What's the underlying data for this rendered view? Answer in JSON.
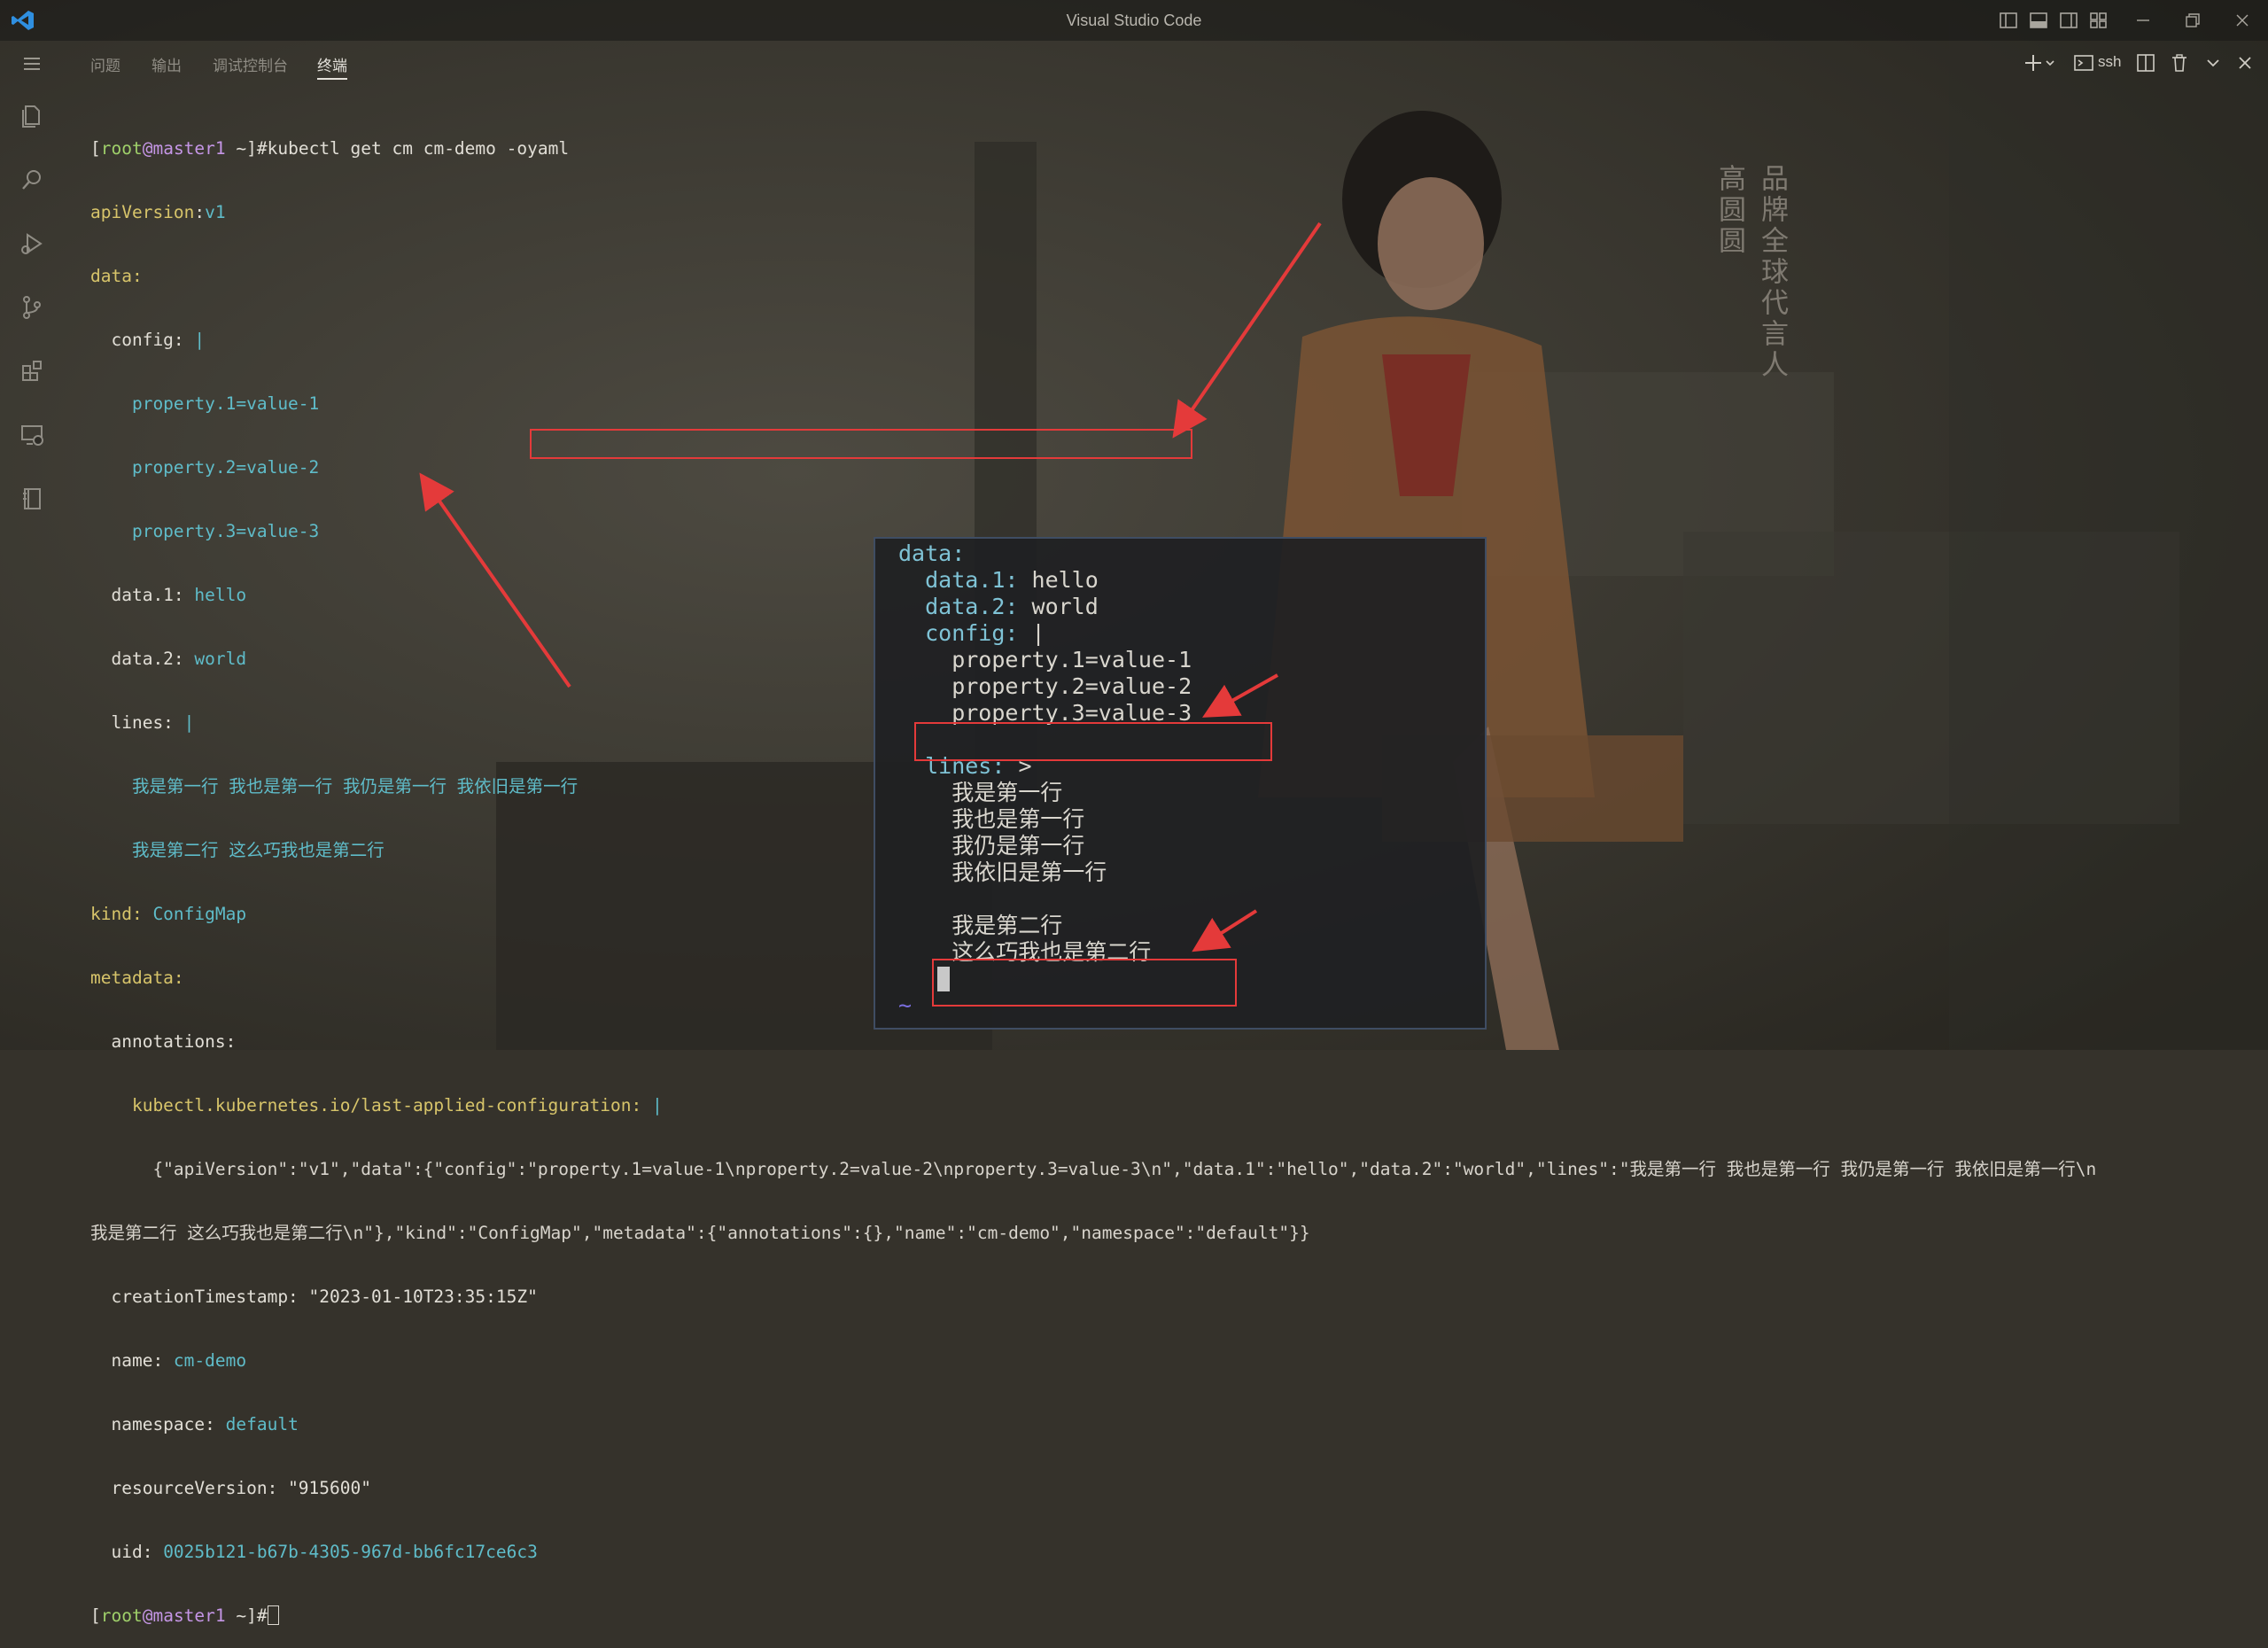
{
  "window": {
    "title": "Visual Studio Code"
  },
  "panel": {
    "tabs": [
      {
        "label": "问题"
      },
      {
        "label": "输出"
      },
      {
        "label": "调试控制台"
      },
      {
        "label": "终端",
        "active": true
      }
    ],
    "terminal_profile": "ssh"
  },
  "terminal": {
    "prompt_user": "root",
    "prompt_host": "@master1",
    "prompt_dir": " ~",
    "command": "#kubectl get cm cm-demo -oyaml",
    "lines": {
      "apiVersion_key": "apiVersion",
      "apiVersion_val": "v1",
      "data_key": "data:",
      "config_key": "  config:",
      "config_pipe": " |",
      "prop1": "    property.1=value-1",
      "prop2": "    property.2=value-2",
      "prop3": "    property.3=value-3",
      "data1_key": "  data.1:",
      "data1_val": " hello",
      "data2_key": "  data.2:",
      "data2_val": " world",
      "lines_key": "  lines:",
      "lines_pipe": " |",
      "lines_row1": "    我是第一行 我也是第一行 我仍是第一行 我依旧是第一行",
      "lines_row2": "    我是第二行 这么巧我也是第二行",
      "kind_key": "kind:",
      "kind_val": " ConfigMap",
      "metadata_key": "metadata:",
      "annotations_key": "  annotations:",
      "last_applied_key": "    kubectl.kubernetes.io/last-applied-configuration:",
      "last_applied_pipe": " |",
      "json_line1": "      {\"apiVersion\":\"v1\",\"data\":{\"config\":\"property.1=value-1\\nproperty.2=value-2\\nproperty.3=value-3\\n\",\"data.1\":\"hello\",\"data.2\":\"world\",\"lines\":\"我是第一行 我也是第一行 我仍是第一行 我依旧是第一行\\n",
      "json_line2": "我是第二行 这么巧我也是第二行\\n\"},\"kind\":\"ConfigMap\",\"metadata\":{\"annotations\":{},\"name\":\"cm-demo\",\"namespace\":\"default\"}}",
      "creation_key": "  creationTimestamp:",
      "creation_val": " \"2023-01-10T23:35:15Z\"",
      "name_key": "  name:",
      "name_val": " cm-demo",
      "namespace_key": "  namespace:",
      "namespace_val": " default",
      "rv_key": "  resourceVersion:",
      "rv_val": " \"915600\"",
      "uid_key": "  uid:",
      "uid_val": " 0025b121-b67b-4305-967d-bb6fc17ce6c3",
      "final_prompt_suffix": "#"
    }
  },
  "vim_overlay": {
    "data_key": "data:",
    "data1_key": "  data.1:",
    "data1_val": " hello",
    "data2_key": "  data.2:",
    "data2_val": " world",
    "config_key": "  config:",
    "config_val": " |",
    "prop1": "    property.1=value-1",
    "prop2": "    property.2=value-2",
    "prop3": "    property.3=value-3",
    "lines_key": "  lines:",
    "lines_val": " >",
    "row1": "    我是第一行",
    "row2": "    我也是第一行",
    "row3": "    我仍是第一行",
    "row4": "    我依旧是第一行",
    "row5": "    我是第二行",
    "row6": "    这么巧我也是第二行",
    "tilde": "~"
  },
  "poster": {
    "col1": "品牌全球代言人",
    "col2": "高圆圆"
  },
  "colors": {
    "annotation": "#e43a3a",
    "yaml_key": "#d7c46a",
    "yaml_value": "#5fbcc9",
    "prompt_user": "#9fd06a",
    "prompt_host": "#c596e6"
  }
}
